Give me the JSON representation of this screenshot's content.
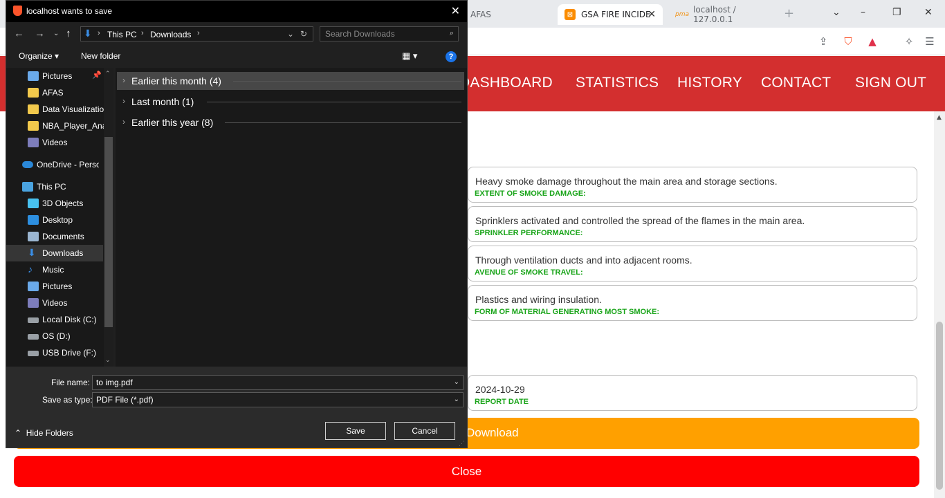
{
  "browser": {
    "tabs": [
      {
        "label": "AFAS",
        "active": false
      },
      {
        "label": "GSA FIRE INCIDE",
        "active": true
      },
      {
        "label": "localhost / 127.0.0.1",
        "active": false
      }
    ],
    "new_tab": "+",
    "window_controls": [
      "–",
      "❐",
      "✕"
    ]
  },
  "nav": {
    "links": [
      "DASHBOARD",
      "STATISTICS",
      "HISTORY",
      "CONTACT",
      "SIGN OUT"
    ]
  },
  "report": {
    "fields": [
      {
        "value": "Heavy smoke damage throughout the main area and storage sections.",
        "label": "EXTENT OF SMOKE DAMAGE:"
      },
      {
        "value": "Sprinklers activated and controlled the spread of the flames in the main area.",
        "label": "SPRINKLER PERFORMANCE:"
      },
      {
        "value": "Through ventilation ducts and into adjacent rooms.",
        "label": "AVENUE OF SMOKE TRAVEL:"
      },
      {
        "value": "Plastics and wiring insulation.",
        "label": "FORM OF MATERIAL GENERATING MOST SMOKE:"
      },
      {
        "value": "2024-10-29",
        "label": "REPORT DATE"
      }
    ],
    "download_label": "Download",
    "close_label": "Close"
  },
  "dialog": {
    "title": "localhost wants to save",
    "breadcrumb": [
      "This PC",
      "Downloads"
    ],
    "search_placeholder": "Search Downloads",
    "organize": "Organize ▾",
    "new_folder": "New folder",
    "help": "?",
    "nav_items": [
      {
        "label": "Pictures",
        "icon": "pictures-icon",
        "color": "#6aa9e9",
        "pinned": true
      },
      {
        "label": "AFAS",
        "icon": "folder-icon",
        "color": "#f2c94c"
      },
      {
        "label": "Data Visualizatio",
        "icon": "folder-icon",
        "color": "#f2c94c"
      },
      {
        "label": "NBA_Player_Ana",
        "icon": "folder-icon",
        "color": "#f2c94c"
      },
      {
        "label": "Videos",
        "icon": "videos-icon",
        "color": "#7d7dbb"
      },
      {
        "label": "OneDrive - Persor",
        "icon": "onedrive-icon",
        "color": "#2b88d8"
      },
      {
        "label": "This PC",
        "icon": "pc-icon",
        "color": "#4aa3df"
      },
      {
        "label": "3D Objects",
        "icon": "3d-objects-icon",
        "color": "#48c2f0"
      },
      {
        "label": "Desktop",
        "icon": "desktop-icon",
        "color": "#2d8fe0"
      },
      {
        "label": "Documents",
        "icon": "documents-icon",
        "color": "#9bb5d0"
      },
      {
        "label": "Downloads",
        "icon": "downloads-icon",
        "color": "#3a8ee6",
        "selected": true
      },
      {
        "label": "Music",
        "icon": "music-icon",
        "color": "#3a8ee6"
      },
      {
        "label": "Pictures",
        "icon": "pictures-icon",
        "color": "#6aa9e9"
      },
      {
        "label": "Videos",
        "icon": "videos-icon",
        "color": "#7d7dbb"
      },
      {
        "label": "Local Disk (C:)",
        "icon": "drive-icon",
        "color": "#9aa0a6"
      },
      {
        "label": "OS (D:)",
        "icon": "drive-icon",
        "color": "#9aa0a6"
      },
      {
        "label": "USB Drive (F:)",
        "icon": "usb-drive-icon",
        "color": "#9aa0a6"
      }
    ],
    "groups": [
      {
        "label": "Earlier this month (4)",
        "selected": true
      },
      {
        "label": "Last month (1)"
      },
      {
        "label": "Earlier this year (8)"
      }
    ],
    "file_name_label": "File name:",
    "file_name": "to img.pdf",
    "save_type_label": "Save as type:",
    "save_type": "PDF File (*.pdf)",
    "hide_folders": "Hide Folders",
    "save": "Save",
    "cancel": "Cancel"
  }
}
